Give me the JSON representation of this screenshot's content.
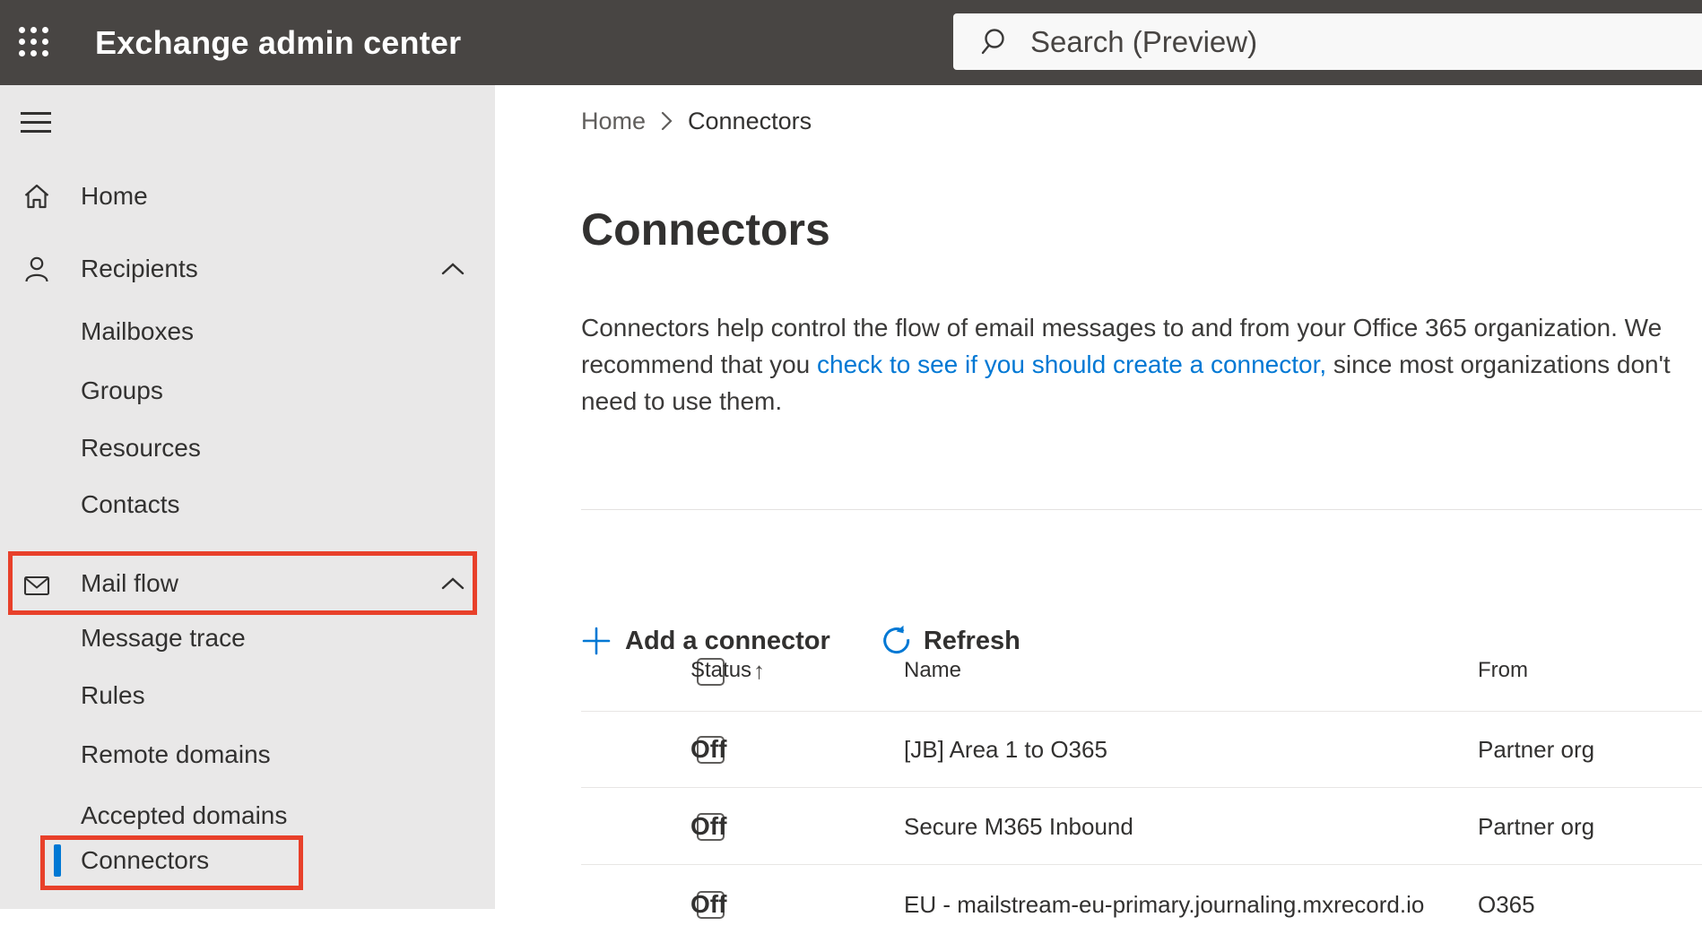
{
  "topbar": {
    "app_title": "Exchange admin center",
    "search_placeholder": "Search (Preview)"
  },
  "sidebar": {
    "items": [
      {
        "label": "Home",
        "level": "top",
        "icon": "home-icon"
      },
      {
        "label": "Recipients",
        "level": "top",
        "icon": "person-icon",
        "expanded": true
      },
      {
        "label": "Mailboxes",
        "level": "sub"
      },
      {
        "label": "Groups",
        "level": "sub"
      },
      {
        "label": "Resources",
        "level": "sub"
      },
      {
        "label": "Contacts",
        "level": "sub"
      },
      {
        "label": "Mail flow",
        "level": "top",
        "icon": "mail-icon",
        "expanded": true,
        "annotated": true
      },
      {
        "label": "Message trace",
        "level": "sub"
      },
      {
        "label": "Rules",
        "level": "sub"
      },
      {
        "label": "Remote domains",
        "level": "sub"
      },
      {
        "label": "Accepted domains",
        "level": "sub"
      },
      {
        "label": "Connectors",
        "level": "sub",
        "selected": true,
        "annotated": true
      }
    ]
  },
  "breadcrumb": {
    "home": "Home",
    "current": "Connectors"
  },
  "main": {
    "title": "Connectors",
    "description": {
      "part1": "Connectors help control the flow of email messages to and from your Office 365 organization. We recommend that you ",
      "link_text": "check to see if you should create a connector,",
      "part2": " since most organizations don't need to use them."
    },
    "toolbar": {
      "add_label": "Add a connector",
      "refresh_label": "Refresh"
    },
    "table": {
      "columns": {
        "status": "Status",
        "name": "Name",
        "from": "From"
      },
      "sort": {
        "column": "Status",
        "direction": "ascending",
        "glyph": "↑"
      },
      "rows": [
        {
          "status": "Off",
          "name": "[JB] Area 1 to O365",
          "from": "Partner org"
        },
        {
          "status": "Off",
          "name": "Secure M365 Inbound",
          "from": "Partner org"
        },
        {
          "status": "Off",
          "name": "EU - mailstream-eu-primary.journaling.mxrecord.io",
          "from": "O365"
        }
      ]
    }
  },
  "icons": [
    "app-launcher-icon",
    "search-icon",
    "hamburger-icon",
    "home-icon",
    "person-icon",
    "mail-icon",
    "chevron-up-icon",
    "chevron-right-icon",
    "plus-icon",
    "refresh-icon",
    "sort-ascending-icon"
  ],
  "colors": {
    "topbar_bg": "#484543",
    "sidebar_bg": "#e9e8e8",
    "accent_blue": "#0078d4",
    "annotation_red": "#e8402a",
    "text_primary": "#323130",
    "text_secondary": "#605e5c",
    "divider": "#e8e6e4"
  }
}
